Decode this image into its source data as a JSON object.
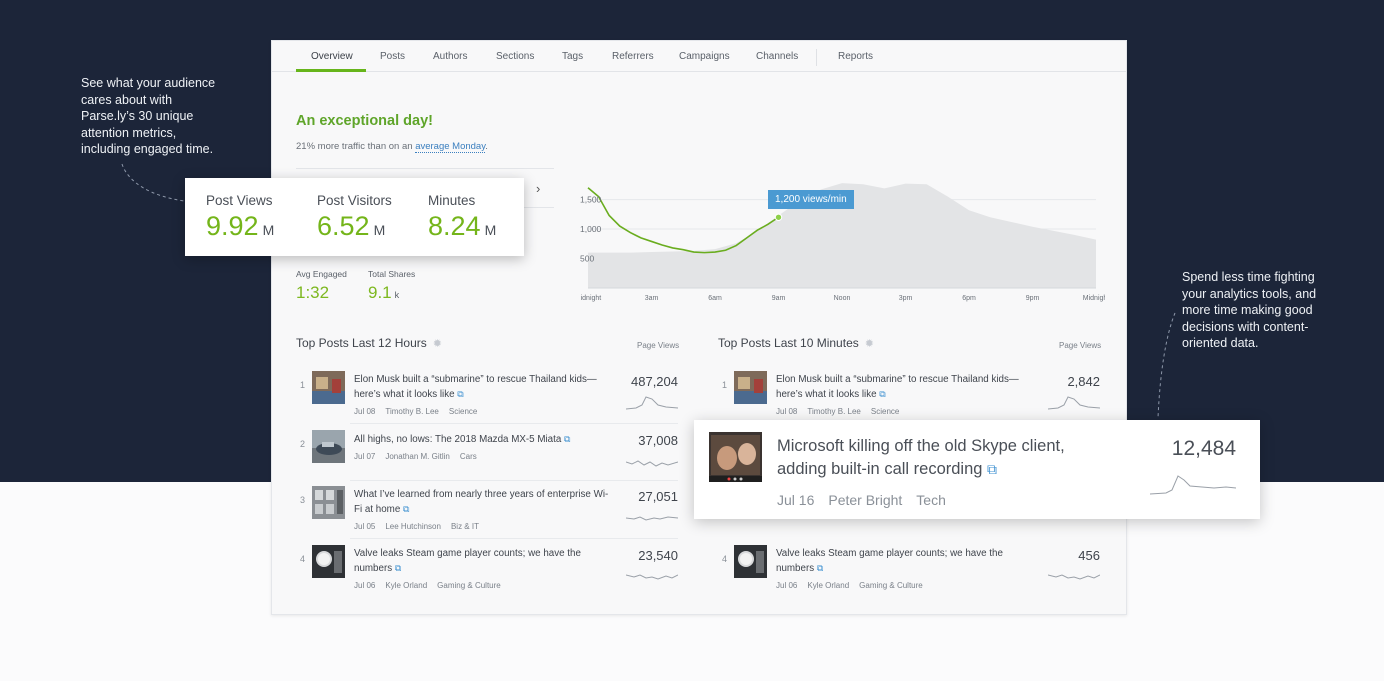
{
  "callouts": {
    "left": "See what your audience cares about with Parse.ly’s 30 unique attention metrics, including engaged time.",
    "right": "Spend less time fighting your analytics tools, and more time making good decisions with content-oriented data."
  },
  "tabs": [
    "Overview",
    "Posts",
    "Authors",
    "Sections",
    "Tags",
    "Referrers",
    "Campaigns",
    "Channels",
    "Reports"
  ],
  "headline": "An exceptional day!",
  "subline": {
    "prefix": "21% more traffic than on an ",
    "link": "average Monday",
    "suffix": "."
  },
  "metrics_card": {
    "items": [
      {
        "label": "Post Views",
        "value": "9.92",
        "unit": "M"
      },
      {
        "label": "Post Visitors",
        "value": "6.52",
        "unit": "M"
      },
      {
        "label": "Minutes",
        "value": "8.24",
        "unit": "M"
      }
    ]
  },
  "small_metrics": [
    {
      "label": "Avg Engaged",
      "value": "1:32",
      "unit": ""
    },
    {
      "label": "Total Shares",
      "value": "9.1",
      "unit": "k"
    }
  ],
  "chart_data": {
    "type": "area",
    "x_labels": [
      "Midnight",
      "3am",
      "6am",
      "9am",
      "Noon",
      "3pm",
      "6pm",
      "9pm",
      "Midnight"
    ],
    "y_ticks": [
      500,
      1000,
      1500
    ],
    "ylim": [
      0,
      1900
    ],
    "today": {
      "x": [
        0,
        0.5,
        1,
        1.5,
        2,
        2.5,
        3,
        3.5,
        4,
        4.5,
        5,
        5.5,
        6,
        6.5,
        7,
        7.5,
        8,
        8.5,
        9
      ],
      "y": [
        1700,
        1550,
        1230,
        1050,
        940,
        850,
        790,
        730,
        680,
        650,
        610,
        600,
        610,
        640,
        720,
        850,
        980,
        1080,
        1200
      ]
    },
    "average": {
      "x": [
        0,
        1,
        2,
        3,
        4,
        5,
        6,
        7,
        8,
        9,
        10,
        11,
        12,
        13,
        14,
        15,
        16,
        17,
        18,
        19,
        20,
        21,
        22,
        23,
        24
      ],
      "y": [
        600,
        600,
        600,
        610,
        620,
        630,
        660,
        760,
        970,
        1230,
        1480,
        1670,
        1780,
        1760,
        1690,
        1770,
        1760,
        1550,
        1320,
        1200,
        1120,
        1040,
        970,
        900,
        820
      ]
    },
    "tooltip": "1,200 views/min"
  },
  "sections": {
    "left": {
      "title": "Top Posts Last 12 Hours",
      "col_label": "Page Views"
    },
    "right": {
      "title": "Top Posts Last 10 Minutes",
      "col_label": "Page Views"
    }
  },
  "posts_left": [
    {
      "rank": "1",
      "title": "Elon Musk built a “submarine” to rescue Thailand kids—here’s what it looks like",
      "date": "Jul 08",
      "author": "Timothy B. Lee",
      "section": "Science",
      "views": "487,204"
    },
    {
      "rank": "2",
      "title": "All highs, no lows: The 2018 Mazda MX-5 Miata",
      "date": "Jul 07",
      "author": "Jonathan M. Gitlin",
      "section": "Cars",
      "views": "37,008"
    },
    {
      "rank": "3",
      "title": "What I’ve learned from nearly three years of enterprise Wi-Fi at home",
      "date": "Jul 05",
      "author": "Lee Hutchinson",
      "section": "Biz & IT",
      "views": "27,051"
    },
    {
      "rank": "4",
      "title": "Valve leaks Steam game player counts; we have the numbers",
      "date": "Jul 06",
      "author": "Kyle Orland",
      "section": "Gaming & Culture",
      "views": "23,540"
    }
  ],
  "posts_right": [
    {
      "rank": "1",
      "title": "Elon Musk built a “submarine” to rescue Thailand kids—here’s what it looks like",
      "date": "Jul 08",
      "author": "Timothy B. Lee",
      "section": "Science",
      "views": "2,842"
    },
    {
      "rank": "4",
      "title": "Valve leaks Steam game player counts; we have the numbers",
      "date": "Jul 06",
      "author": "Kyle Orland",
      "section": "Gaming & Culture",
      "views": "456"
    }
  ],
  "featured_post": {
    "title": "Microsoft killing off the old Skype client, adding built-in call recording",
    "date": "Jul 16",
    "author": "Peter Bright",
    "section": "Tech",
    "views": "12,484"
  },
  "colors": {
    "navy": "#1c2539",
    "accent_green": "#67b51b",
    "link_blue": "#3b8fd0",
    "tooltip_blue": "#4b9ad2"
  },
  "icons": {
    "external_link": "external-link-icon",
    "gear": "gear-icon",
    "chevron": "chevron-right-icon"
  }
}
